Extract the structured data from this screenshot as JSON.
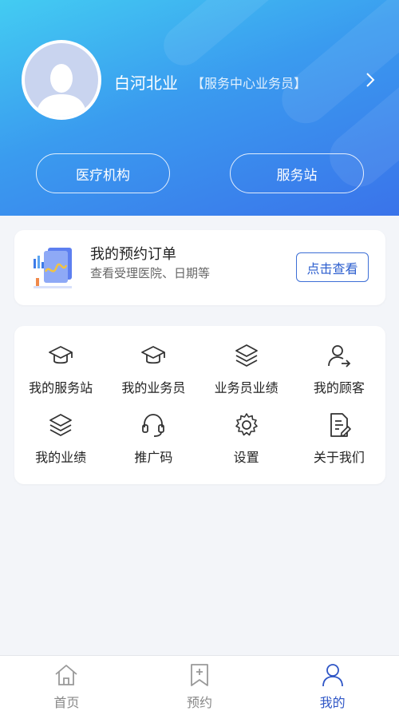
{
  "colors": {
    "accent": "#2f56c6",
    "header_start": "#43ccf2",
    "header_end": "#3a73ea"
  },
  "profile": {
    "name": "白河北业",
    "role": "【服务中心业务员】",
    "buttons": {
      "medical": "医疗机构",
      "station": "服务站"
    }
  },
  "order": {
    "title": "我的预约订单",
    "subtitle": "查看受理医院、日期等",
    "button": "点击查看"
  },
  "menu": {
    "items": [
      {
        "label": "我的服务站",
        "icon": "graduation-cap-icon"
      },
      {
        "label": "我的业务员",
        "icon": "graduation-cap-icon"
      },
      {
        "label": "业务员业绩",
        "icon": "layers-icon"
      },
      {
        "label": "我的顾客",
        "icon": "user-arrow-icon"
      },
      {
        "label": "我的业绩",
        "icon": "layers-icon"
      },
      {
        "label": "推广码",
        "icon": "headset-icon"
      },
      {
        "label": "设置",
        "icon": "gear-icon"
      },
      {
        "label": "关于我们",
        "icon": "document-edit-icon"
      }
    ]
  },
  "tabbar": {
    "items": [
      {
        "label": "首页",
        "icon": "home-icon",
        "active": false
      },
      {
        "label": "预约",
        "icon": "bookmark-plus-icon",
        "active": false
      },
      {
        "label": "我的",
        "icon": "user-icon",
        "active": true
      }
    ]
  }
}
